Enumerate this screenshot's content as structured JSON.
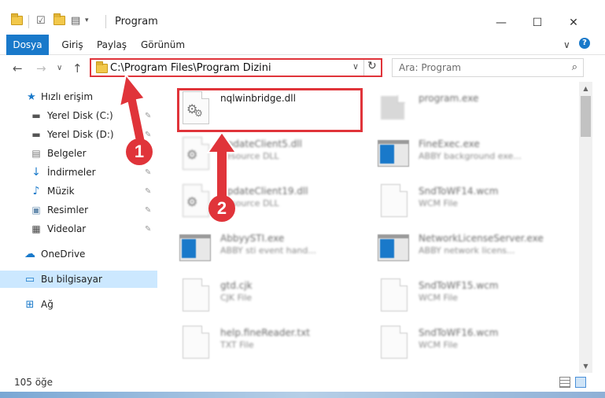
{
  "window": {
    "title": "Program",
    "minimize_glyph": "—",
    "maximize_glyph": "☐",
    "close_glyph": "✕"
  },
  "ribbon": {
    "tabs": [
      "Dosya",
      "Giriş",
      "Paylaş",
      "Görünüm"
    ],
    "expand_glyph": "∨",
    "help_glyph": "?"
  },
  "nav": {
    "back_glyph": "←",
    "forward_glyph": "→",
    "recent_glyph": "∨",
    "up_glyph": "↑",
    "address": "C:\\Program Files\\Program Dizini",
    "address_dropdown_glyph": "∨",
    "refresh_glyph": "↻",
    "search_placeholder": "Ara: Program",
    "search_glyph": "⌕"
  },
  "sidebar": {
    "quick_access": "Hızlı erişim",
    "items": [
      {
        "label": "Yerel Disk (C:)",
        "icon": "drive-icon"
      },
      {
        "label": "Yerel Disk (D:)",
        "icon": "drive-icon"
      },
      {
        "label": "Belgeler",
        "icon": "documents-icon"
      },
      {
        "label": "İndirmeler",
        "icon": "downloads-icon"
      },
      {
        "label": "Müzik",
        "icon": "music-icon"
      },
      {
        "label": "Resimler",
        "icon": "pictures-icon"
      },
      {
        "label": "Videolar",
        "icon": "videos-icon"
      }
    ],
    "onedrive": "OneDrive",
    "this_pc": "Bu bilgisayar",
    "network": "Ağ",
    "pin_glyph": "📌"
  },
  "files": [
    {
      "name": "nqlwinbridge.dll",
      "type": "",
      "icon": "dll-icon",
      "blurred": false
    },
    {
      "name": "program.exe",
      "type": "",
      "icon": "exe-icon",
      "blurred": true
    },
    {
      "name": "UpdateClient5.dll",
      "type": "Resource DLL",
      "icon": "dll-icon",
      "blurred": true
    },
    {
      "name": "FineExec.exe",
      "type": "ABBY background exe...",
      "icon": "app-icon",
      "blurred": true
    },
    {
      "name": "UpdateClient19.dll",
      "type": "Resource DLL",
      "icon": "dll-icon",
      "blurred": true
    },
    {
      "name": "SndToWF14.wcm",
      "type": "WCM File",
      "icon": "file-icon",
      "blurred": true
    },
    {
      "name": "AbbyySTI.exe",
      "type": "ABBY sti event hand...",
      "icon": "app-icon",
      "blurred": true
    },
    {
      "name": "NetworkLicenseServer.exe",
      "type": "ABBY network licens...",
      "icon": "app-icon",
      "blurred": true
    },
    {
      "name": "gtd.cjk",
      "type": "CJK File",
      "icon": "file-icon",
      "blurred": true
    },
    {
      "name": "SndToWF15.wcm",
      "type": "WCM File",
      "icon": "file-icon",
      "blurred": true
    },
    {
      "name": "help.fineReader.txt",
      "type": "TXT File",
      "icon": "file-icon",
      "blurred": true
    },
    {
      "name": "SndToWF16.wcm",
      "type": "WCM File",
      "icon": "file-icon",
      "blurred": true
    }
  ],
  "status": {
    "count": "105 öğe"
  },
  "annotations": {
    "badge1": "1",
    "badge2": "2"
  },
  "colors": {
    "accent": "#1979ca",
    "annotation_red": "#e0343a",
    "selected_bg": "#cce8ff"
  }
}
